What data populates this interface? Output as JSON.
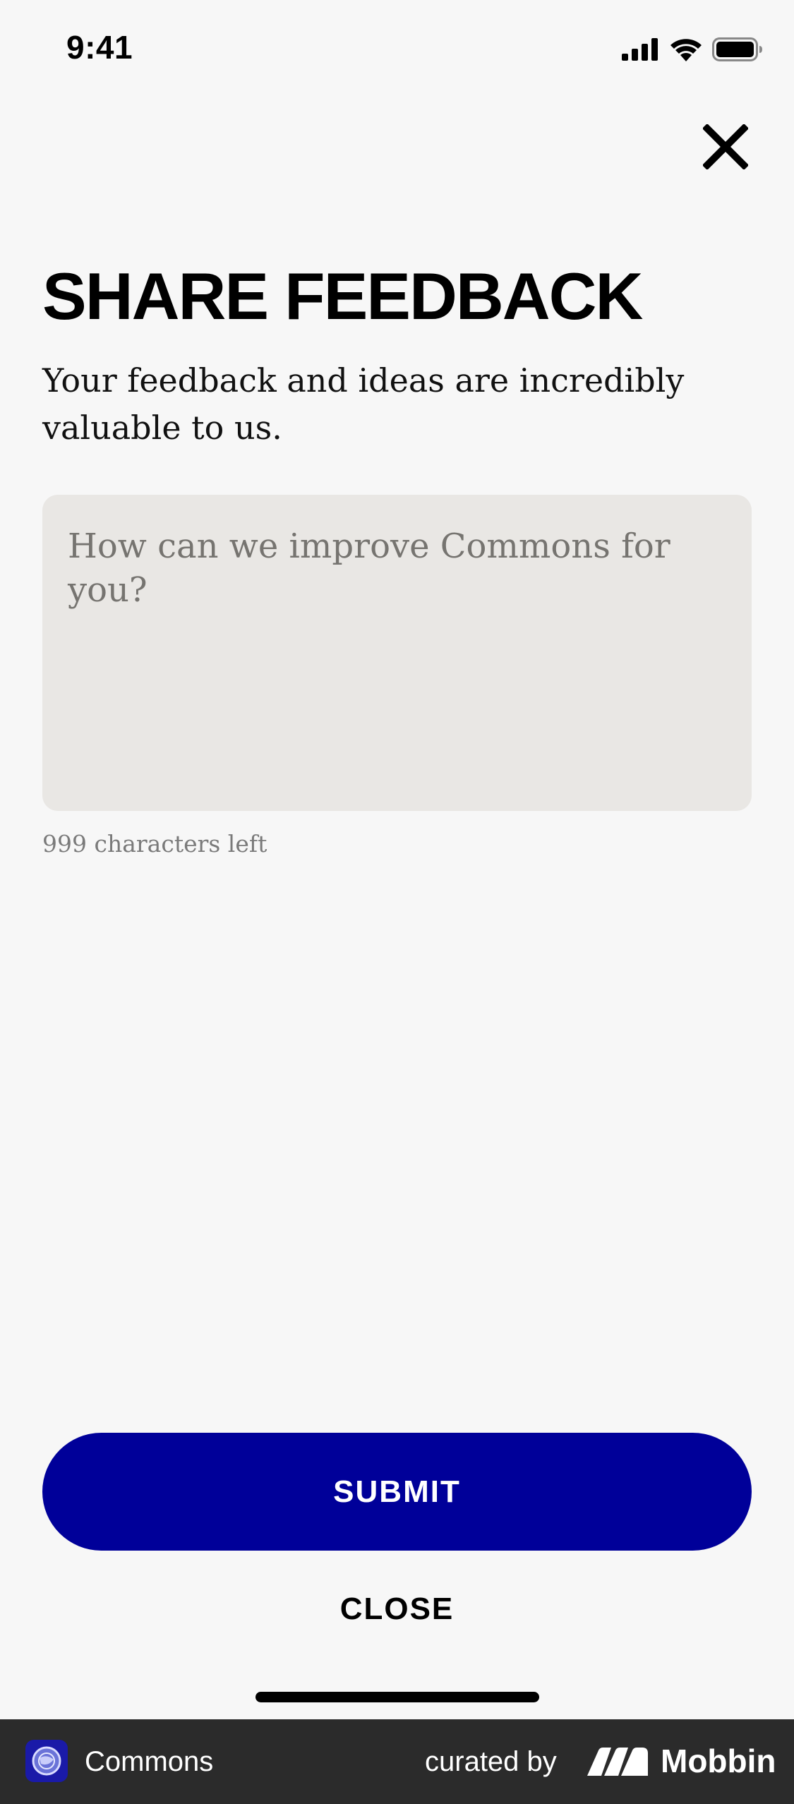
{
  "status_bar": {
    "time": "9:41"
  },
  "header": {
    "close_icon": "close-x-icon"
  },
  "main": {
    "title": "SHARE FEEDBACK",
    "subtitle": "Your feedback and ideas are incredibly valuable to us.",
    "feedback_input": {
      "value": "",
      "placeholder": "How can we improve Commons for you?"
    },
    "char_count": "999 characters left"
  },
  "actions": {
    "submit_label": "SUBMIT",
    "close_label": "CLOSE"
  },
  "footer": {
    "app_name": "Commons",
    "curated_label": "curated by",
    "brand_name": "Mobbin"
  },
  "colors": {
    "background": "#f7f7f7",
    "primary_button": "#000099",
    "input_background": "#e9e7e4",
    "footer_background": "#2b2b2b"
  },
  "icons": {
    "signal": "cellular-signal-icon",
    "wifi": "wifi-icon",
    "battery": "battery-icon",
    "close": "close-x-icon",
    "app": "commons-app-icon",
    "brand": "mobbin-logo-icon"
  }
}
